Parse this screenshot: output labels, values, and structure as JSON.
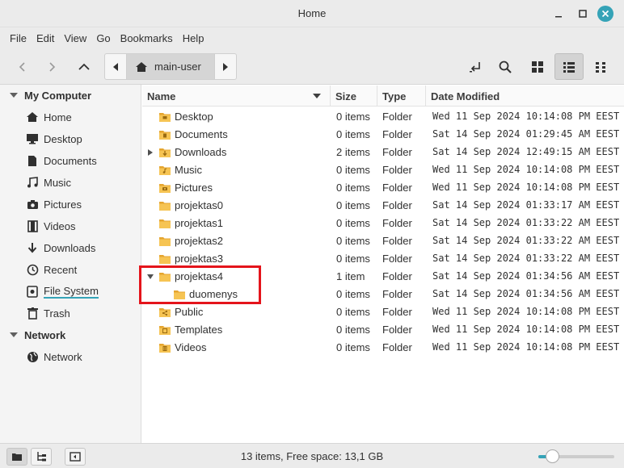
{
  "window": {
    "title": "Home"
  },
  "menu": [
    "File",
    "Edit",
    "View",
    "Go",
    "Bookmarks",
    "Help"
  ],
  "pathbar": {
    "crumb": "main-user"
  },
  "sidebar": {
    "sections": [
      {
        "header": "My Computer",
        "items": [
          {
            "label": "Home",
            "icon": "home-icon"
          },
          {
            "label": "Desktop",
            "icon": "desktop-icon"
          },
          {
            "label": "Documents",
            "icon": "document-icon"
          },
          {
            "label": "Music",
            "icon": "music-icon"
          },
          {
            "label": "Pictures",
            "icon": "camera-icon"
          },
          {
            "label": "Videos",
            "icon": "film-icon"
          },
          {
            "label": "Downloads",
            "icon": "download-icon"
          },
          {
            "label": "Recent",
            "icon": "clock-icon"
          },
          {
            "label": "File System",
            "icon": "drive-icon"
          },
          {
            "label": "Trash",
            "icon": "trash-icon"
          }
        ]
      },
      {
        "header": "Network",
        "items": [
          {
            "label": "Network",
            "icon": "globe-icon"
          }
        ]
      }
    ]
  },
  "columns": {
    "name": "Name",
    "size": "Size",
    "type": "Type",
    "date": "Date Modified"
  },
  "files": [
    {
      "name": "Desktop",
      "size": "0 items",
      "type": "Folder",
      "date": "Wed 11 Sep 2024 10:14:08 PM EEST",
      "level": 0,
      "expander": "",
      "emblem": "desktop"
    },
    {
      "name": "Documents",
      "size": "0 items",
      "type": "Folder",
      "date": "Sat 14 Sep 2024 01:29:45 AM EEST",
      "level": 0,
      "expander": "",
      "emblem": "document"
    },
    {
      "name": "Downloads",
      "size": "2 items",
      "type": "Folder",
      "date": "Sat 14 Sep 2024 12:49:15 AM EEST",
      "level": 0,
      "expander": "collapsed",
      "emblem": "download"
    },
    {
      "name": "Music",
      "size": "0 items",
      "type": "Folder",
      "date": "Wed 11 Sep 2024 10:14:08 PM EEST",
      "level": 0,
      "expander": "",
      "emblem": "music"
    },
    {
      "name": "Pictures",
      "size": "0 items",
      "type": "Folder",
      "date": "Wed 11 Sep 2024 10:14:08 PM EEST",
      "level": 0,
      "expander": "",
      "emblem": "camera"
    },
    {
      "name": "projektas0",
      "size": "0 items",
      "type": "Folder",
      "date": "Sat 14 Sep 2024 01:33:17 AM EEST",
      "level": 0,
      "expander": "",
      "emblem": ""
    },
    {
      "name": "projektas1",
      "size": "0 items",
      "type": "Folder",
      "date": "Sat 14 Sep 2024 01:33:22 AM EEST",
      "level": 0,
      "expander": "",
      "emblem": ""
    },
    {
      "name": "projektas2",
      "size": "0 items",
      "type": "Folder",
      "date": "Sat 14 Sep 2024 01:33:22 AM EEST",
      "level": 0,
      "expander": "",
      "emblem": ""
    },
    {
      "name": "projektas3",
      "size": "0 items",
      "type": "Folder",
      "date": "Sat 14 Sep 2024 01:33:22 AM EEST",
      "level": 0,
      "expander": "",
      "emblem": ""
    },
    {
      "name": "projektas4",
      "size": "1 item",
      "type": "Folder",
      "date": "Sat 14 Sep 2024 01:34:56 AM EEST",
      "level": 0,
      "expander": "expanded",
      "emblem": ""
    },
    {
      "name": "duomenys",
      "size": "0 items",
      "type": "Folder",
      "date": "Sat 14 Sep 2024 01:34:56 AM EEST",
      "level": 1,
      "expander": "",
      "emblem": ""
    },
    {
      "name": "Public",
      "size": "0 items",
      "type": "Folder",
      "date": "Wed 11 Sep 2024 10:14:08 PM EEST",
      "level": 0,
      "expander": "",
      "emblem": "share"
    },
    {
      "name": "Templates",
      "size": "0 items",
      "type": "Folder",
      "date": "Wed 11 Sep 2024 10:14:08 PM EEST",
      "level": 0,
      "expander": "",
      "emblem": "template"
    },
    {
      "name": "Videos",
      "size": "0 items",
      "type": "Folder",
      "date": "Wed 11 Sep 2024 10:14:08 PM EEST",
      "level": 0,
      "expander": "",
      "emblem": "film"
    }
  ],
  "status": {
    "text": "13 items, Free space: 13,1 GB",
    "zoom_level": 0.18
  },
  "colors": {
    "accent": "#35a3b7",
    "folder": "#f6c453",
    "folder_dark": "#e5a52f",
    "highlight": "#e4141b"
  }
}
